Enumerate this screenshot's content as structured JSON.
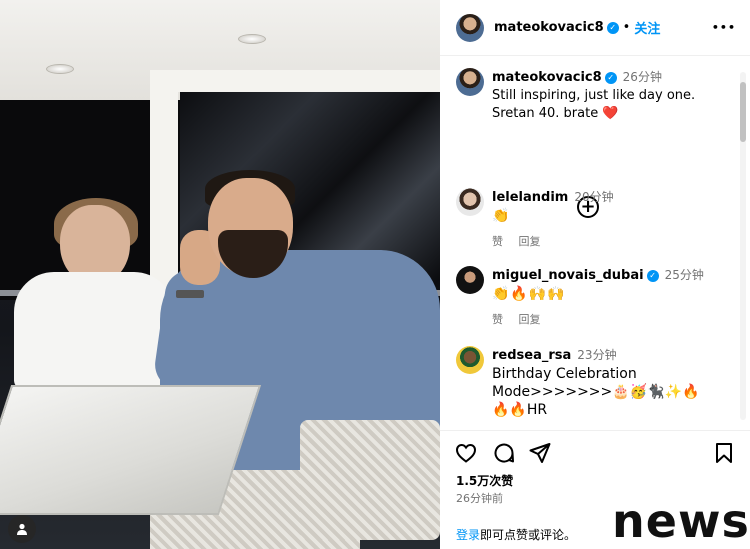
{
  "post": {
    "author": "mateokovacic8",
    "follow_label": "关注",
    "more_label": "•••",
    "caption_time": "26分钟",
    "caption_line1": "Still inspiring, just like day one.",
    "caption_line2": "Sretan 40. brate",
    "caption_emoji": "❤️"
  },
  "comments": [
    {
      "user": "lelelandim",
      "time": "20分钟",
      "text": "👏",
      "like_label": "赞",
      "reply_label": "回复",
      "verified": false
    },
    {
      "user": "miguel_novais_dubai",
      "time": "25分钟",
      "text": "👏🔥🙌🙌",
      "like_label": "赞",
      "reply_label": "回复",
      "verified": true
    },
    {
      "user": "redsea_rsa",
      "time": "23分钟",
      "text_line1": "Birthday Celebration",
      "text_line2": "Mode>>>>>>>🎂🥳🐈‍⬛✨🔥",
      "text_line3": "🔥🔥HR",
      "verified": false
    }
  ],
  "engagement": {
    "likes": "1.5万次赞",
    "posted": "26分钟前",
    "login_link": "登录",
    "login_rest": "即可点赞或评论。"
  },
  "watermark": "news",
  "colors": {
    "accent": "#0095f6",
    "heart": "#ed4956",
    "muted": "#737373"
  },
  "icons": [
    "heart-icon",
    "comment-icon",
    "share-icon",
    "bookmark-icon",
    "add-comment-icon",
    "verified-icon",
    "more-icon",
    "user-tag-icon"
  ]
}
